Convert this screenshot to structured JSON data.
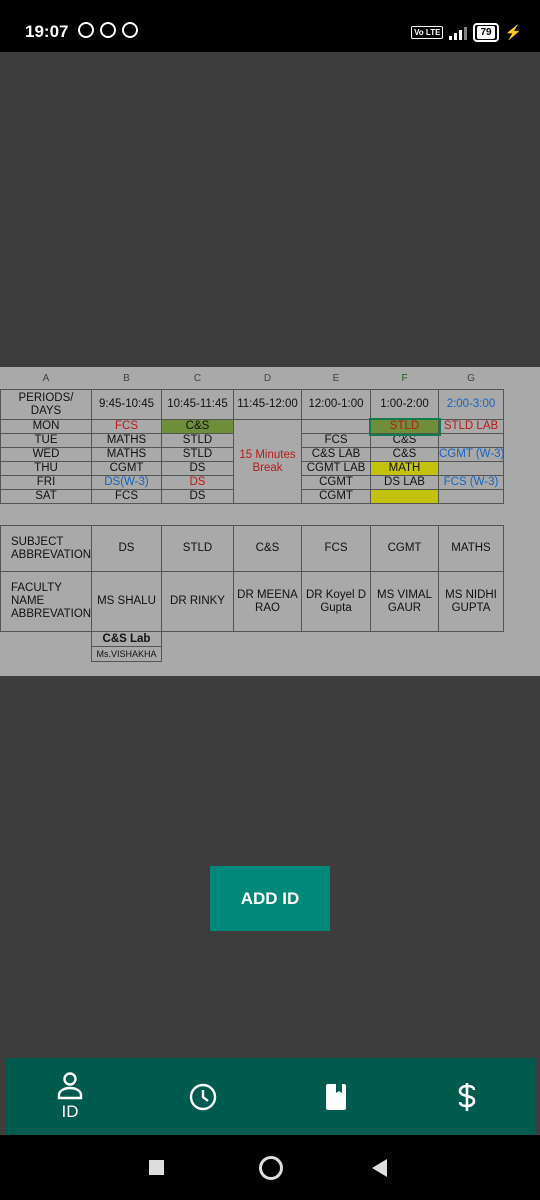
{
  "status_bar": {
    "time": "19:07",
    "volte": "Vo LTE",
    "battery": "79"
  },
  "timetable": {
    "columns": [
      "A",
      "B",
      "C",
      "D",
      "E",
      "F",
      "G"
    ],
    "periods_label": "PERIODS/ DAYS",
    "times": [
      "9:45-10:45",
      "10:45-11:45",
      "11:45-12:00",
      "12:00-1:00",
      "1:00-2:00",
      "2:00-3:00"
    ],
    "break_text": "15 Minutes Break",
    "days": [
      {
        "day": "MON",
        "b": "FCS",
        "c": "C&S",
        "e": "",
        "f": "STLD",
        "g": "STLD LAB"
      },
      {
        "day": "TUE",
        "b": "MATHS",
        "c": "STLD",
        "e": "FCS",
        "f": "C&S",
        "g": ""
      },
      {
        "day": "WED",
        "b": "MATHS",
        "c": "STLD",
        "e": "C&S LAB",
        "f": "C&S",
        "g": "CGMT (W-3)"
      },
      {
        "day": "THU",
        "b": "CGMT",
        "c": "DS",
        "e": "CGMT LAB",
        "f": "MATH",
        "g": ""
      },
      {
        "day": "FRI",
        "b": "DS(W-3)",
        "c": "DS",
        "e": "CGMT",
        "f": "DS LAB",
        "g": "FCS (W-3)"
      },
      {
        "day": "SAT",
        "b": "FCS",
        "c": "DS",
        "e": "CGMT",
        "f": "",
        "g": ""
      }
    ],
    "subject_label": "SUBJECT ABBREVATION",
    "subjects": [
      "DS",
      "STLD",
      "C&S",
      "FCS",
      "CGMT",
      "MATHS"
    ],
    "faculty_label": "FACULTY NAME ABBREVATION",
    "faculty": [
      "MS SHALU",
      "DR RINKY",
      "DR MEENA RAO",
      "DR Koyel D Gupta",
      "MS VIMAL GAUR",
      "MS NIDHI GUPTA"
    ],
    "lab_title": "C&S Lab",
    "lab_faculty": "Ms.VISHAKHA"
  },
  "add_button": "ADD ID",
  "nav": {
    "id_label": "ID"
  }
}
